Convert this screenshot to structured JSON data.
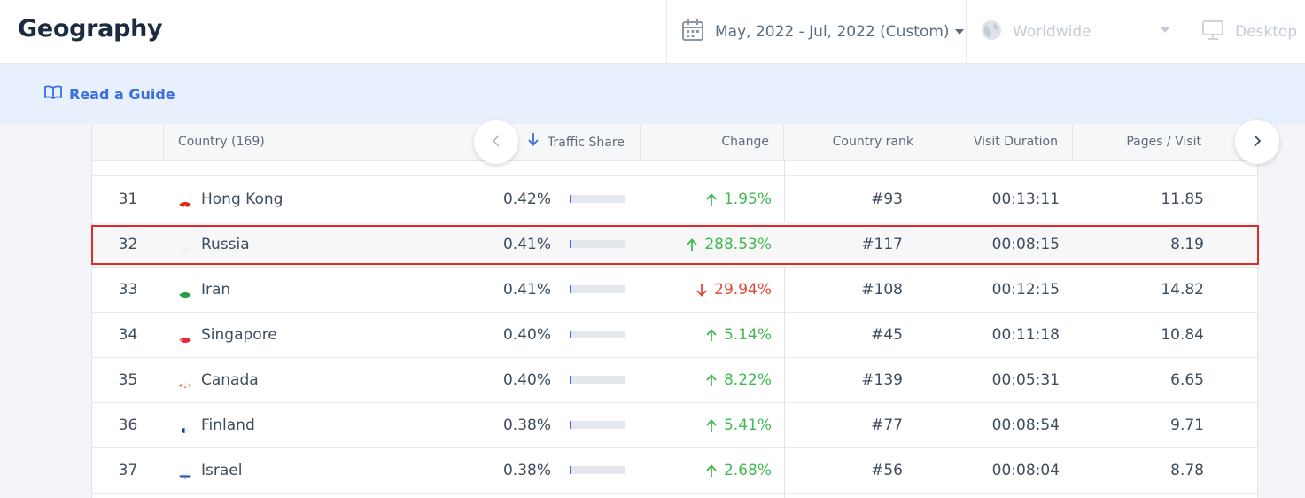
{
  "header": {
    "title": "Geography",
    "date_range": "May, 2022 - Jul, 2022 (Custom)",
    "region": "Worldwide",
    "device": "Desktop"
  },
  "guide": {
    "label": "Read a Guide"
  },
  "table": {
    "columns": {
      "country": "Country (169)",
      "traffic_share": "Traffic Share",
      "change": "Change",
      "country_rank": "Country rank",
      "visit_duration": "Visit Duration",
      "pages_visit": "Pages / Visit"
    },
    "rows": [
      {
        "rank": "31",
        "country": "Hong Kong",
        "flag": "hong-kong-flag-icon",
        "share": "0.42%",
        "share_value": 0.42,
        "change": "1.95%",
        "direction": "up",
        "country_rank": "#93",
        "duration": "00:13:11",
        "pages": "11.85"
      },
      {
        "rank": "32",
        "country": "Russia",
        "flag": "russia-flag-icon",
        "share": "0.41%",
        "share_value": 0.41,
        "change": "288.53%",
        "direction": "up",
        "country_rank": "#117",
        "duration": "00:08:15",
        "pages": "8.19"
      },
      {
        "rank": "33",
        "country": "Iran",
        "flag": "iran-flag-icon",
        "share": "0.41%",
        "share_value": 0.41,
        "change": "29.94%",
        "direction": "down",
        "country_rank": "#108",
        "duration": "00:12:15",
        "pages": "14.82"
      },
      {
        "rank": "34",
        "country": "Singapore",
        "flag": "singapore-flag-icon",
        "share": "0.40%",
        "share_value": 0.4,
        "change": "5.14%",
        "direction": "up",
        "country_rank": "#45",
        "duration": "00:11:18",
        "pages": "10.84"
      },
      {
        "rank": "35",
        "country": "Canada",
        "flag": "canada-flag-icon",
        "share": "0.40%",
        "share_value": 0.4,
        "change": "8.22%",
        "direction": "up",
        "country_rank": "#139",
        "duration": "00:05:31",
        "pages": "6.65"
      },
      {
        "rank": "36",
        "country": "Finland",
        "flag": "finland-flag-icon",
        "share": "0.38%",
        "share_value": 0.38,
        "change": "5.41%",
        "direction": "up",
        "country_rank": "#77",
        "duration": "00:08:54",
        "pages": "9.71"
      },
      {
        "rank": "37",
        "country": "Israel",
        "flag": "israel-flag-icon",
        "share": "0.38%",
        "share_value": 0.38,
        "change": "2.68%",
        "direction": "up",
        "country_rank": "#56",
        "duration": "00:08:04",
        "pages": "8.78"
      }
    ]
  },
  "colors": {
    "accent": "#3a6fe0",
    "up": "#3fb950",
    "down": "#e0493b",
    "highlight": "#e12a2a"
  }
}
